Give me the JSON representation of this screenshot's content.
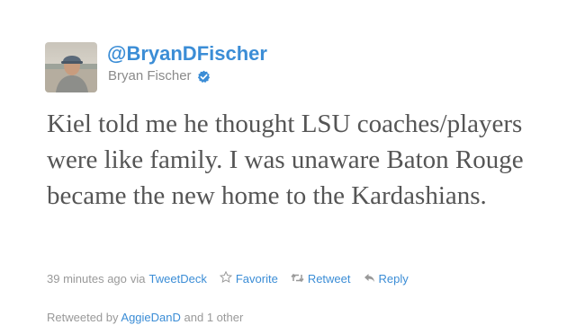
{
  "tweet": {
    "handle": "@BryanDFischer",
    "display_name": "Bryan Fischer",
    "text": "Kiel told me he thought LSU coaches/players were like family. I was unaware Baton Rouge became the new home to the Kardashians.",
    "timestamp": "39 minutes ago",
    "via_label": "via",
    "source": "TweetDeck"
  },
  "actions": {
    "favorite_label": "Favorite",
    "retweet_label": "Retweet",
    "reply_label": "Reply"
  },
  "retweeted": {
    "prefix": "Retweeted by",
    "user": "AggieDanD",
    "suffix": "and 1 other"
  },
  "colors": {
    "link": "#3b8dd6",
    "muted": "#999999",
    "tweet_text": "#555555",
    "verified_badge": "#3b8dd6"
  },
  "icons": {
    "verified": "verified-badge-icon",
    "favorite": "star-icon",
    "retweet": "retweet-icon",
    "reply": "reply-icon"
  }
}
